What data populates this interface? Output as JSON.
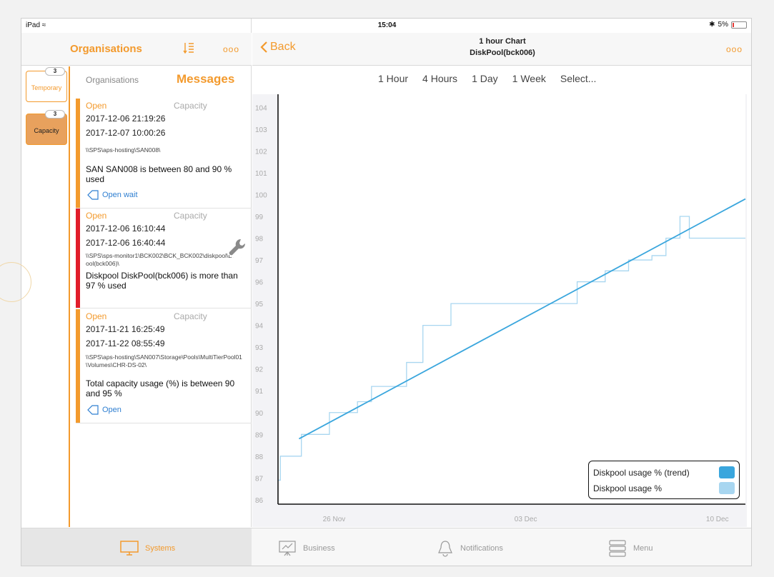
{
  "status": {
    "device": "iPad",
    "time": "15:04",
    "battery": "5%"
  },
  "left": {
    "title": "Organisations",
    "more": "ooo",
    "vtabs": [
      {
        "badge": "3",
        "label": "Temporary"
      },
      {
        "badge": "3",
        "label": "Capacity"
      }
    ],
    "segments": {
      "a": "Organisations",
      "b": "Messages"
    },
    "messages": [
      {
        "status": "Open",
        "category": "Capacity",
        "date1": "2017-12-06 21:19:26",
        "date2": "2017-12-07 10:00:26",
        "path": "\\\\SPS\\aps-hosting\\SAN008\\",
        "text": "SAN SAN008 is between 80 and 90 % used",
        "link": "Open wait"
      },
      {
        "status": "Open",
        "category": "Capacity",
        "date1": "2017-12-06 16:10:44",
        "date2": "2017-12-06 16:40:44",
        "path": "\\\\SPS\\sps-monitor1\\BCK002\\BCK_BCK002\\diskpool\\DiskPool(bck006)\\",
        "text": "Diskpool DiskPool(bck006) is more than 97 % used",
        "link": ""
      },
      {
        "status": "Open",
        "category": "Capacity",
        "date1": "2017-11-21 16:25:49",
        "date2": "2017-11-22 08:55:49",
        "path": "\\\\SPS\\aps-hosting\\SAN007\\Storage\\Pools\\MultiTierPool01\\Volumes\\CHR-DS-02\\",
        "text": "Total capacity usage (%) is between 90 and 95 %",
        "link": "Open"
      }
    ]
  },
  "right": {
    "back": "Back",
    "title1": "1 hour Chart",
    "title2": "DiskPool(bck006)",
    "more": "ooo",
    "ranges": [
      "1 Hour",
      "4 Hours",
      "1 Day",
      "1 Week",
      "Select..."
    ]
  },
  "tabbar": [
    "Systems",
    "Business",
    "Notifications",
    "Menu"
  ],
  "colors": {
    "accent": "#f39a2d",
    "trend": "#3aa6dd",
    "usage": "#a8d6f0",
    "critical": "#e11d2a"
  },
  "chart_data": {
    "type": "line",
    "x_ticks": [
      "26 Nov",
      "03 Dec",
      "10 Dec"
    ],
    "y_ticks": [
      86,
      87,
      88,
      89,
      90,
      91,
      92,
      93,
      94,
      95,
      96,
      97,
      98,
      99,
      100,
      101,
      102,
      103,
      104
    ],
    "ylim": [
      85.8,
      104.6
    ],
    "legend_position": "bottom-right",
    "series": [
      {
        "name": "Diskpool usage % (trend)",
        "color": "#3aa6dd",
        "x": [
          0.045,
          1.0
        ],
        "y": [
          88.8,
          99.8
        ]
      },
      {
        "name": "Diskpool usage %",
        "color": "#a8d6f0",
        "x": [
          0.0,
          0.005,
          0.005,
          0.05,
          0.05,
          0.11,
          0.11,
          0.17,
          0.17,
          0.2,
          0.2,
          0.275,
          0.275,
          0.31,
          0.31,
          0.37,
          0.37,
          0.64,
          0.64,
          0.7,
          0.7,
          0.75,
          0.75,
          0.8,
          0.8,
          0.83,
          0.83,
          0.86,
          0.86,
          0.88,
          0.88,
          0.92,
          0.92,
          1.0
        ],
        "y": [
          86.9,
          86.9,
          88.0,
          88.0,
          89.0,
          89.0,
          90.0,
          90.0,
          90.5,
          90.5,
          91.2,
          91.2,
          92.3,
          92.3,
          94.0,
          94.0,
          95.0,
          95.0,
          96.0,
          96.0,
          96.5,
          96.5,
          97.0,
          97.0,
          97.2,
          97.2,
          98.0,
          98.0,
          99.0,
          99.0,
          98.0,
          98.0,
          98.0,
          98.0
        ]
      }
    ]
  }
}
